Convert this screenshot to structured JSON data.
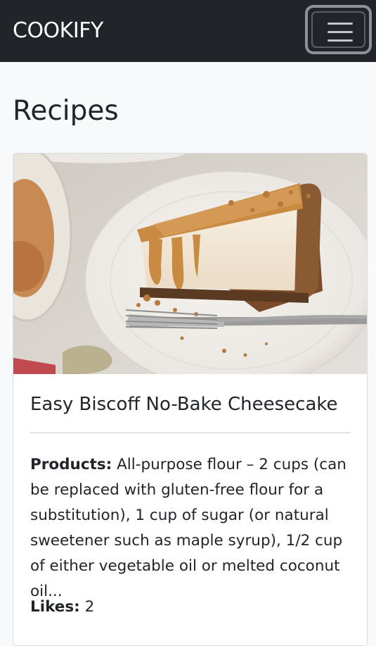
{
  "navbar": {
    "brand": "COOKIFY",
    "toggler_icon": "hamburger-menu-icon"
  },
  "page": {
    "title": "Recipes"
  },
  "recipe_card": {
    "image_alt": "Slice of Biscoff cheesecake on a plate with a fork",
    "title": "Easy Biscoff No-Bake Cheesecake",
    "products_label": "Products:",
    "products_text": "All-purpose flour – 2 cups (can be replaced with gluten-free flour for a substitution), 1 cup of sugar (or natural sweetener such as maple syrup), 1/2 cup of either vegetable oil or melted coconut oil...",
    "likes_label": "Likes:",
    "likes_value": "2"
  },
  "colors": {
    "navbar_bg": "#212529",
    "page_bg": "#f8f9fa",
    "card_bg": "#ffffff",
    "text": "#212529"
  }
}
